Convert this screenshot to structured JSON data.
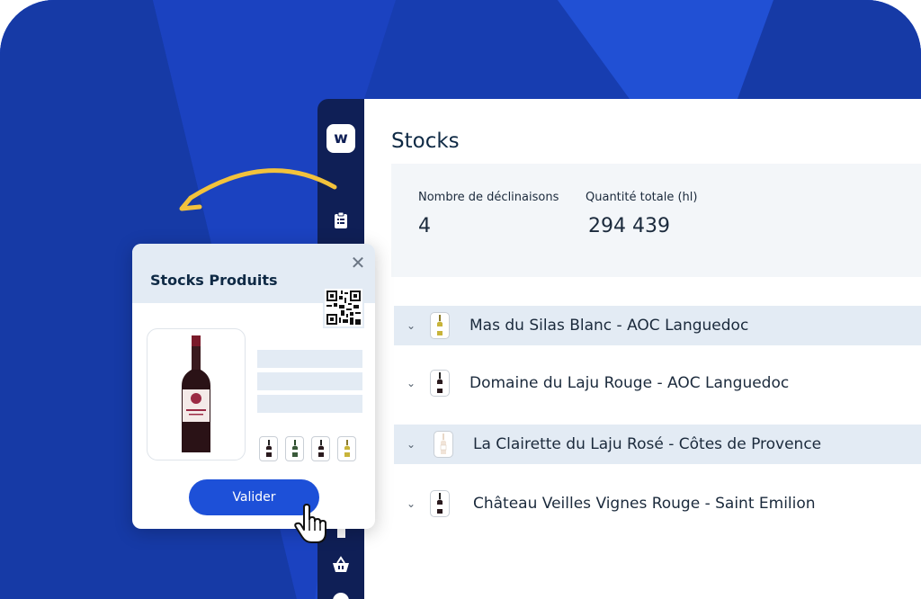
{
  "app": {
    "logo_letter": "w",
    "brand_color": "#1d50d8",
    "sidebar_color": "#0f1f56",
    "sidebar_icons": [
      "clipboard-icon",
      "tag-icon",
      "basket-icon",
      "compass-icon"
    ]
  },
  "stocks": {
    "title": "Stocks",
    "stats": [
      {
        "label": "Nombre de déclinaisons",
        "value": "4"
      },
      {
        "label": "Quantité totale (hl)",
        "value": "294 439"
      }
    ],
    "products": [
      {
        "name": "Mas du Silas Blanc - AOC Languedoc",
        "wine": "white"
      },
      {
        "name": "Domaine du Laju Rouge - AOC Languedoc",
        "wine": "red"
      },
      {
        "name": "La Clairette du Laju Rosé - Côtes de Provence",
        "wine": "rose"
      },
      {
        "name": "Château Veilles Vignes Rouge - Saint Emilion",
        "wine": "red"
      }
    ]
  },
  "modal": {
    "title": "Stocks Produits",
    "close_icon": "close-icon",
    "qr_icon": "qr-code-icon",
    "variant_thumbs": [
      "red",
      "green",
      "red",
      "white"
    ],
    "validate_label": "Valider"
  }
}
